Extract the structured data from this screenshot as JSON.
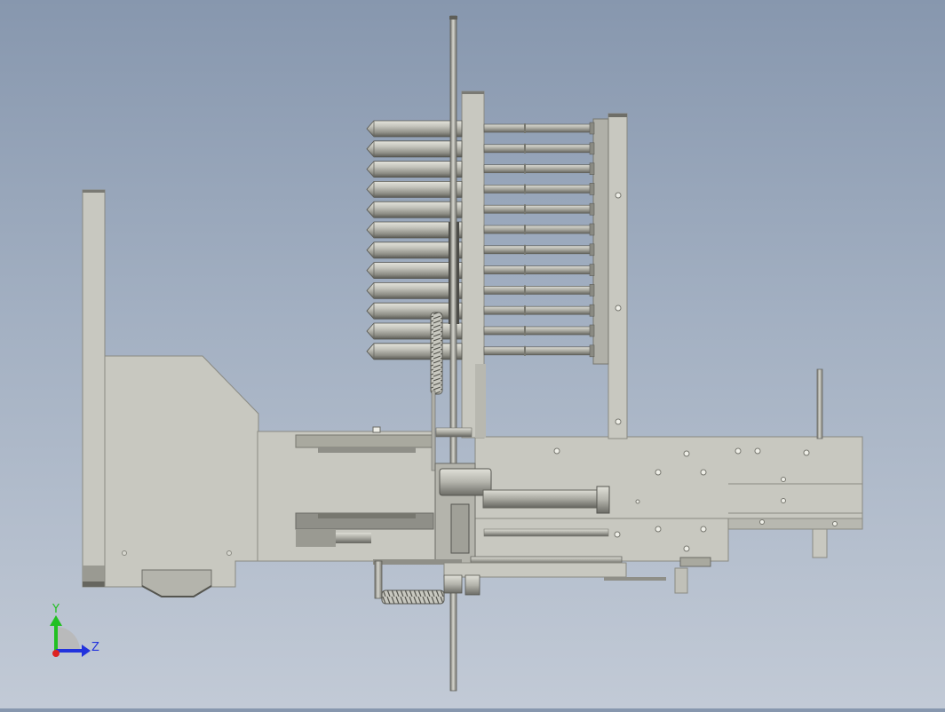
{
  "viewport": {
    "background_top": "#8797ae",
    "background_bottom": "#c2cad6"
  },
  "model": {
    "body_color": "#c8c8c0",
    "shade_color": "#a9a99f",
    "dark_color": "#6e6e68",
    "edge_color": "#55554f",
    "pin_count_left": 12,
    "pin_count_right": 12
  },
  "triad": {
    "y_label": "Y",
    "z_label": "Z",
    "y_color": "#22c022",
    "z_color": "#2233dd",
    "x_color": "#dd2222"
  }
}
